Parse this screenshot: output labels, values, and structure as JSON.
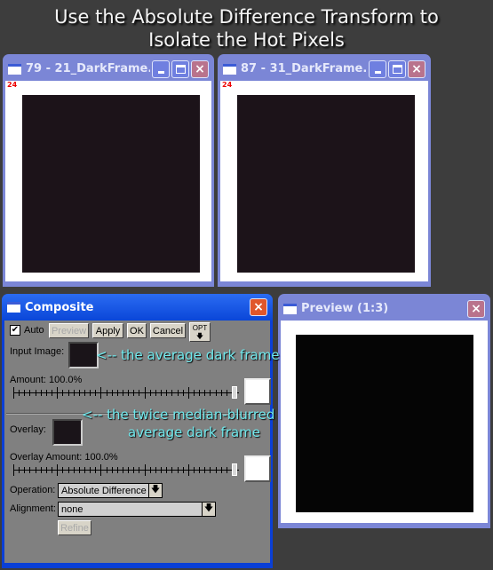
{
  "heading": {
    "line1": "Use the Absolute Difference Transform to",
    "line2": "Isolate the Hot Pixels"
  },
  "windows": {
    "frame1": {
      "title": "79 - 21_DarkFrame...",
      "badge": "24"
    },
    "frame2": {
      "title": "87 - 31_DarkFrame...",
      "badge": "24"
    },
    "preview": {
      "title": "Preview (1:3)"
    }
  },
  "composite": {
    "title": "Composite",
    "auto_label": "Auto",
    "auto_checked": true,
    "check_mark": "✔",
    "preview_label": "Preview",
    "apply_label": "Apply",
    "ok_label": "OK",
    "cancel_label": "Cancel",
    "opt_label": "OPT",
    "opt_arrow": "🡇",
    "input_image_label": "Input Image:",
    "amount_label": "Amount: 100.0%",
    "amount_value": 100.0,
    "overlay_label": "Overlay:",
    "overlay_amount_label": "Overlay Amount: 100.0%",
    "overlay_amount_value": 100.0,
    "operation_label": "Operation:",
    "operation_value": "Absolute Difference",
    "alignment_label": "Alignment:",
    "alignment_value": "none",
    "refine_label": "Refine",
    "dropdown_arrow": "🡇"
  },
  "annotations": {
    "input": "<-- the average dark frame",
    "overlay_line1": "<-- the twice median-blurred",
    "overlay_line2": "average dark frame"
  },
  "icons": {
    "minimize": "minimize-icon",
    "maximize": "maximize-icon",
    "close": "×"
  }
}
